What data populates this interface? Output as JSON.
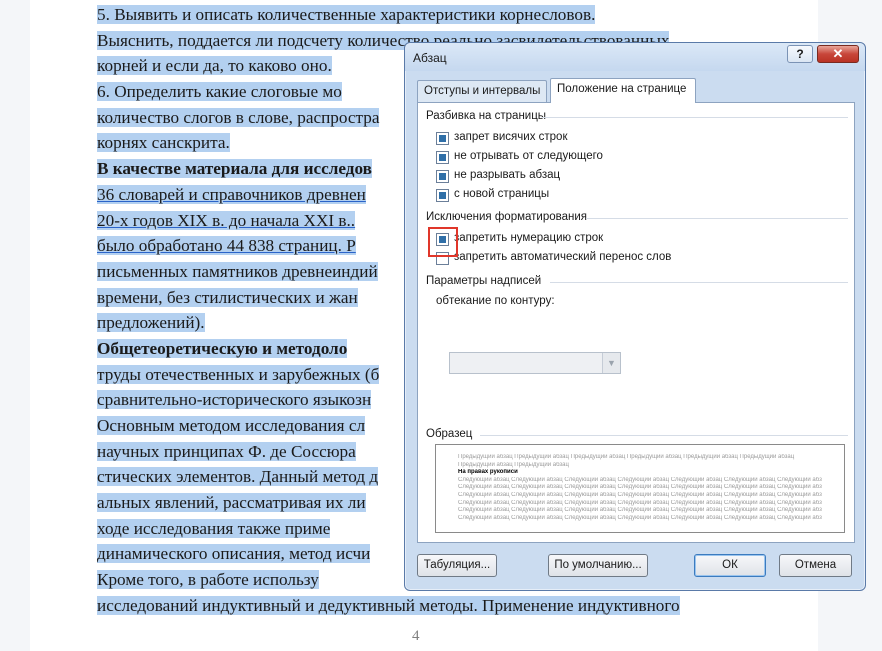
{
  "document": {
    "lines": [
      "5. Выявить и описать количественные характеристики корнесловов.",
      "Выяснить, поддается ли подсчету количество реально засвидетельствованных",
      "корней и если да, то каково оно.",
      "6. Определить какие слоговые мо",
      "количество слогов в слове, распростра",
      "корнях санскрита.",
      "В качестве материала для исследов",
      "36 словарей и справочников древнен",
      "20-х годов XIX в. до начала XXI в..",
      "было обработано 44 838 страниц. Р",
      "письменных памятников древнеиндий",
      "времени, без стилистических и жан",
      "предложений).",
      "Общетеоретическую и методоло",
      "труды отечественных и зарубежных (б",
      "сравнительно-исторического языкозн",
      "Основным методом исследования сл",
      "научных принципах Ф. де Соссюра",
      "стических элементов. Данный метод д",
      "альных явлений, рассматривая их ли",
      "ходе исследования также приме",
      "динамического описания, метод исчи",
      "Кроме того, в работе использу",
      "исследований индуктивный и дедуктивный методы. Применение индуктивного"
    ],
    "page_number": "4"
  },
  "dialog": {
    "title": "Абзац",
    "help": "?",
    "close": "✕",
    "tabs": [
      {
        "label": "Отступы и интервалы",
        "active": false
      },
      {
        "label": "Положение на странице",
        "active": true
      }
    ],
    "pagination": {
      "heading": "Разбивка на страницы",
      "items": [
        {
          "label": "запрет висячих строк",
          "checked": true
        },
        {
          "label": "не отрывать от следующего",
          "checked": true
        },
        {
          "label": "не разрывать абзац",
          "checked": true
        },
        {
          "label": "с новой страницы",
          "checked": true
        }
      ]
    },
    "exceptions": {
      "heading": "Исключения форматирования",
      "items": [
        {
          "label": "запретить нумерацию строк",
          "checked": true
        },
        {
          "label": "запретить автоматический перенос слов",
          "checked": false
        }
      ]
    },
    "textbox": {
      "heading": "Параметры надписей",
      "wrap_label": "обтекание по контуру:",
      "wrap_value": ""
    },
    "preview": {
      "heading": "Образец",
      "prev_text": "Предыдущий абзац Предыдущий абзац Предыдущий абзац Предыдущий абзац Предыдущий абзац Предыдущий абзац",
      "prev_text2": "Предыдущий абзац Предыдущий абзац",
      "current_text": "На правах рукописи",
      "next_text": "Следующий абзац Следующий абзац Следующий абзац Следующий абзац Следующий абзац Следующий абзац Следующий абзац"
    },
    "buttons": {
      "tabs": "Табуляция...",
      "default": "По умолчанию...",
      "ok": "ОК",
      "cancel": "Отмена"
    },
    "colors": {
      "selection": "#b3d0f0",
      "highlight_box": "#e0362a",
      "close_button": "#c8463a"
    }
  }
}
